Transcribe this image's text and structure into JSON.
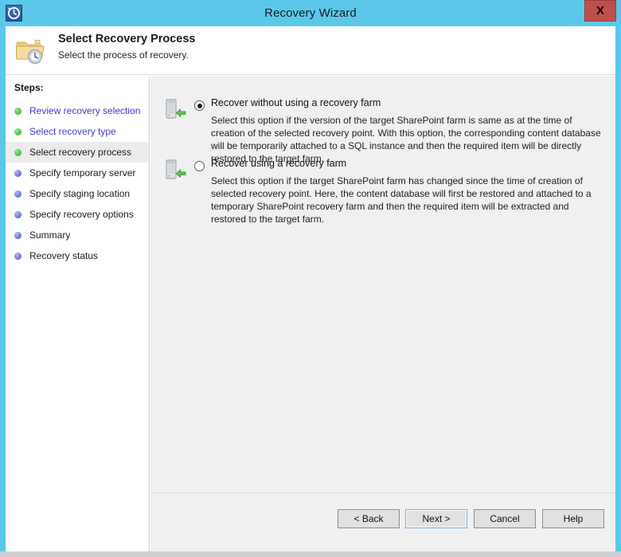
{
  "window": {
    "title": "Recovery Wizard",
    "app_icon": "restore-clock-icon",
    "close_label": "X",
    "accent_color": "#5bc8ea",
    "close_color": "#c0504d"
  },
  "header": {
    "icon": "folder-clock-icon",
    "title": "Select Recovery Process",
    "subtitle": "Select the process of recovery."
  },
  "sidebar": {
    "label": "Steps:",
    "items": [
      {
        "label": "Review recovery selection",
        "state": "done",
        "style": "link"
      },
      {
        "label": "Select recovery type",
        "state": "done",
        "style": "link"
      },
      {
        "label": "Select recovery process",
        "state": "done",
        "style": "current"
      },
      {
        "label": "Specify temporary server",
        "state": "todo",
        "style": "plain"
      },
      {
        "label": "Specify staging location",
        "state": "todo",
        "style": "plain"
      },
      {
        "label": "Specify recovery options",
        "state": "todo",
        "style": "plain"
      },
      {
        "label": "Summary",
        "state": "todo",
        "style": "plain"
      },
      {
        "label": "Recovery status",
        "state": "todo",
        "style": "plain"
      }
    ],
    "bullet_done_color": "#57c44f",
    "bullet_todo_color": "#7a7fd8",
    "link_color": "#3a3ad8"
  },
  "content": {
    "options": [
      {
        "icon": "server-restore-icon",
        "title": "Recover without using a recovery farm",
        "selected": true,
        "description": "Select this option if the version of the target SharePoint farm is same as at the time of creation of the selected recovery point. With this option, the corresponding content database will be temporarily attached to a SQL instance and then the required item will be directly restored to the target farm."
      },
      {
        "icon": "server-restore-icon",
        "title": "Recover using a recovery farm",
        "selected": false,
        "description": "Select this option if the target SharePoint farm has changed since the time of creation of selected recovery point. Here, the content database will first be restored and attached to a temporary SharePoint recovery farm and then the required item will be extracted and restored to the target farm."
      }
    ]
  },
  "buttons": {
    "back": "< Back",
    "next": "Next >",
    "cancel": "Cancel",
    "help": "Help",
    "focused": "next"
  }
}
